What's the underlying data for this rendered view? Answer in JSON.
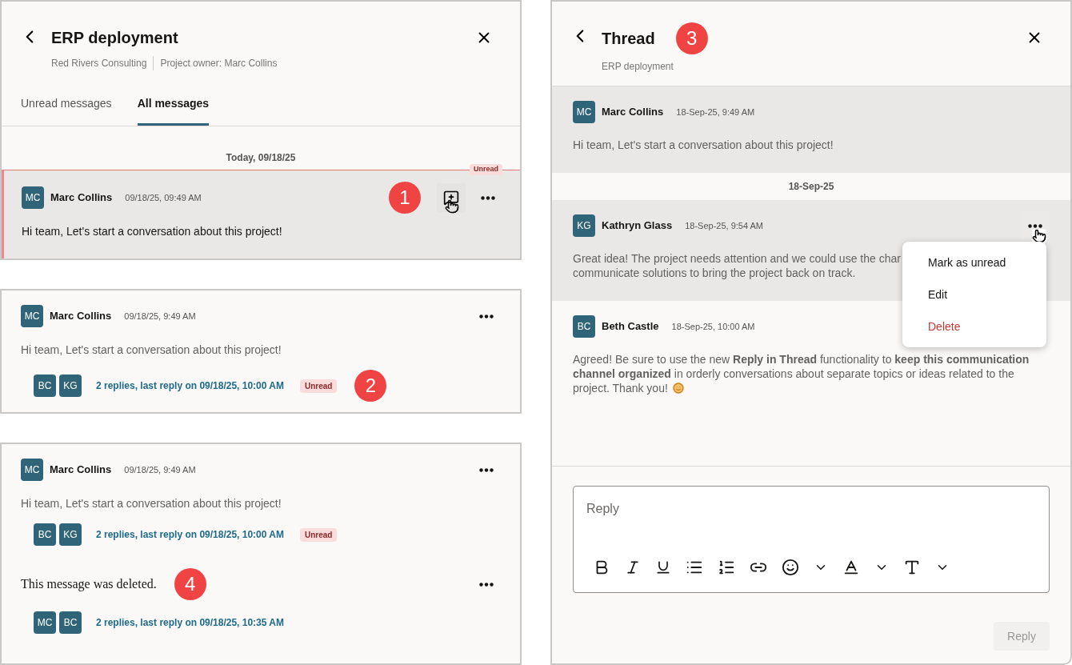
{
  "main_panel": {
    "title": "ERP deployment",
    "meta": [
      "Red Rivers Consulting",
      "Project owner: Marc Collins"
    ],
    "tabs": [
      {
        "label": "Unread messages",
        "selected": false
      },
      {
        "label": "All messages",
        "selected": true
      }
    ],
    "date_divider": "Today, 09/18/25",
    "unread_label": "Unread",
    "message": {
      "initials": "MC",
      "author": "Marc Collins",
      "time": "09/18/25, 09:49 AM",
      "text": "Hi team, Let's start a conversation about this project!",
      "unread": true
    },
    "callout": "1"
  },
  "thread_cards": [
    {
      "items": [
        {
          "kind": "message",
          "initials": "MC",
          "author": "Marc Collins",
          "time": "09/18/25, 9:49 AM",
          "text": "Hi team, Let's start a conversation about this project!",
          "replies": {
            "avatars": [
              "BC",
              "KG"
            ],
            "summary": "2 replies, last reply on 09/18/25, 10:00 AM",
            "badge": "Unread"
          },
          "callout": "2"
        }
      ]
    },
    {
      "items": [
        {
          "kind": "message",
          "initials": "MC",
          "author": "Marc Collins",
          "time": "09/18/25, 9:49 AM",
          "text": "Hi team, Let's start a conversation about this project!",
          "replies": {
            "avatars": [
              "BC",
              "KG"
            ],
            "summary": "2 replies, last reply on 09/18/25, 10:00 AM",
            "badge": "Unread"
          }
        },
        {
          "kind": "deleted",
          "text": "This message was deleted.",
          "callout": "4",
          "replies": {
            "avatars": [
              "MC",
              "BC"
            ],
            "summary": "2 replies, last reply on 09/18/25, 10:35 AM"
          }
        }
      ]
    }
  ],
  "thread_panel": {
    "title": "Thread",
    "callout": "3",
    "subtitle": "ERP deployment",
    "items": [
      {
        "kind": "message",
        "initials": "MC",
        "author": "Marc Collins",
        "time": "18-Sep-25, 9:49 AM",
        "lines": [
          "Hi team, Let's start a conversation about this project!"
        ],
        "highlighted": true,
        "menu_open": false
      },
      {
        "kind": "divider",
        "label": "18-Sep-25"
      },
      {
        "kind": "message",
        "initials": "KG",
        "author": "Kathryn Glass",
        "time": "18-Sep-25, 9:54 AM",
        "lines": [
          "Great idea! The project needs attention and we could use the char",
          "communicate solutions to bring the project back on track."
        ],
        "highlighted": true,
        "menu_open": true
      },
      {
        "kind": "message",
        "initials": "BC",
        "author": "Beth Castle",
        "time": "18-Sep-25, 10:00 AM",
        "lines": [
          "Agreed! Be sure to use the new **Reply in Thread** functionality to **keep this communication**",
          "**channel organized** in orderly conversations about separate topics or ideas related to the",
          "project. Thank you!"
        ],
        "emoji": true,
        "highlighted": false,
        "menu_open": false
      }
    ],
    "menu": [
      {
        "label": "Mark as unread",
        "danger": false
      },
      {
        "label": "Edit",
        "danger": false
      },
      {
        "label": "Delete",
        "danger": true
      }
    ],
    "reply_field": {
      "placeholder": "Reply"
    },
    "reply_button": {
      "label": "Reply",
      "disabled": true
    }
  }
}
